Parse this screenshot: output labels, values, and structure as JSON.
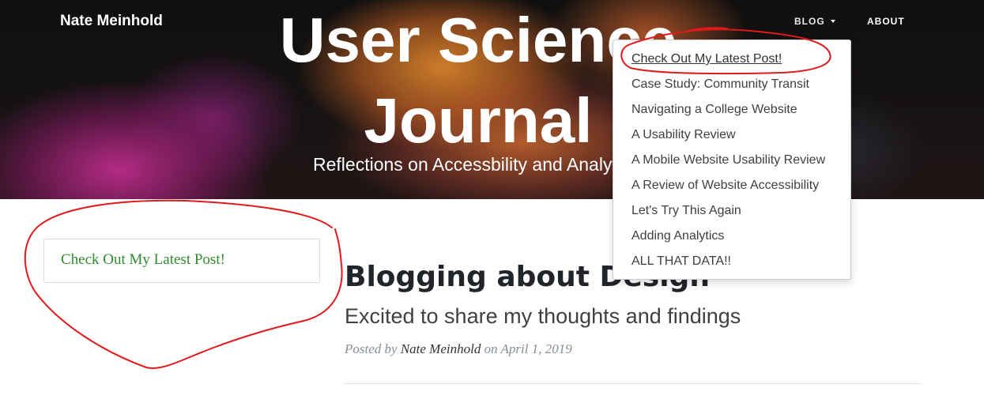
{
  "navbar": {
    "brand": "Nate Meinhold",
    "blog_label": "BLOG",
    "about_label": "ABOUT"
  },
  "header": {
    "title_line1": "User Science",
    "title_line2": "Journal",
    "subtitle": "Reflections on Accessbility and Analytics"
  },
  "blog_dropdown": {
    "items": [
      {
        "label": "Check Out My Latest Post!"
      },
      {
        "label": "Case Study: Community Transit"
      },
      {
        "label": "Navigating a College Website"
      },
      {
        "label": "A Usability Review"
      },
      {
        "label": "A Mobile Website Usability Review"
      },
      {
        "label": "A Review of Website Accessibility"
      },
      {
        "label": "Let's Try This Again"
      },
      {
        "label": "Adding Analytics"
      },
      {
        "label": "ALL THAT DATA!!"
      }
    ]
  },
  "sidebar": {
    "link_label": "Check Out My Latest Post!"
  },
  "post": {
    "title": "Blogging about Design",
    "subtitle": "Excited to share my thoughts and findings",
    "posted_by": "Posted by",
    "author": "Nate Meinhold",
    "on_text": "on",
    "date": "April 1, 2019"
  },
  "colors": {
    "annotation": "#e0191b",
    "sidebar_link": "#2e8b2e"
  }
}
